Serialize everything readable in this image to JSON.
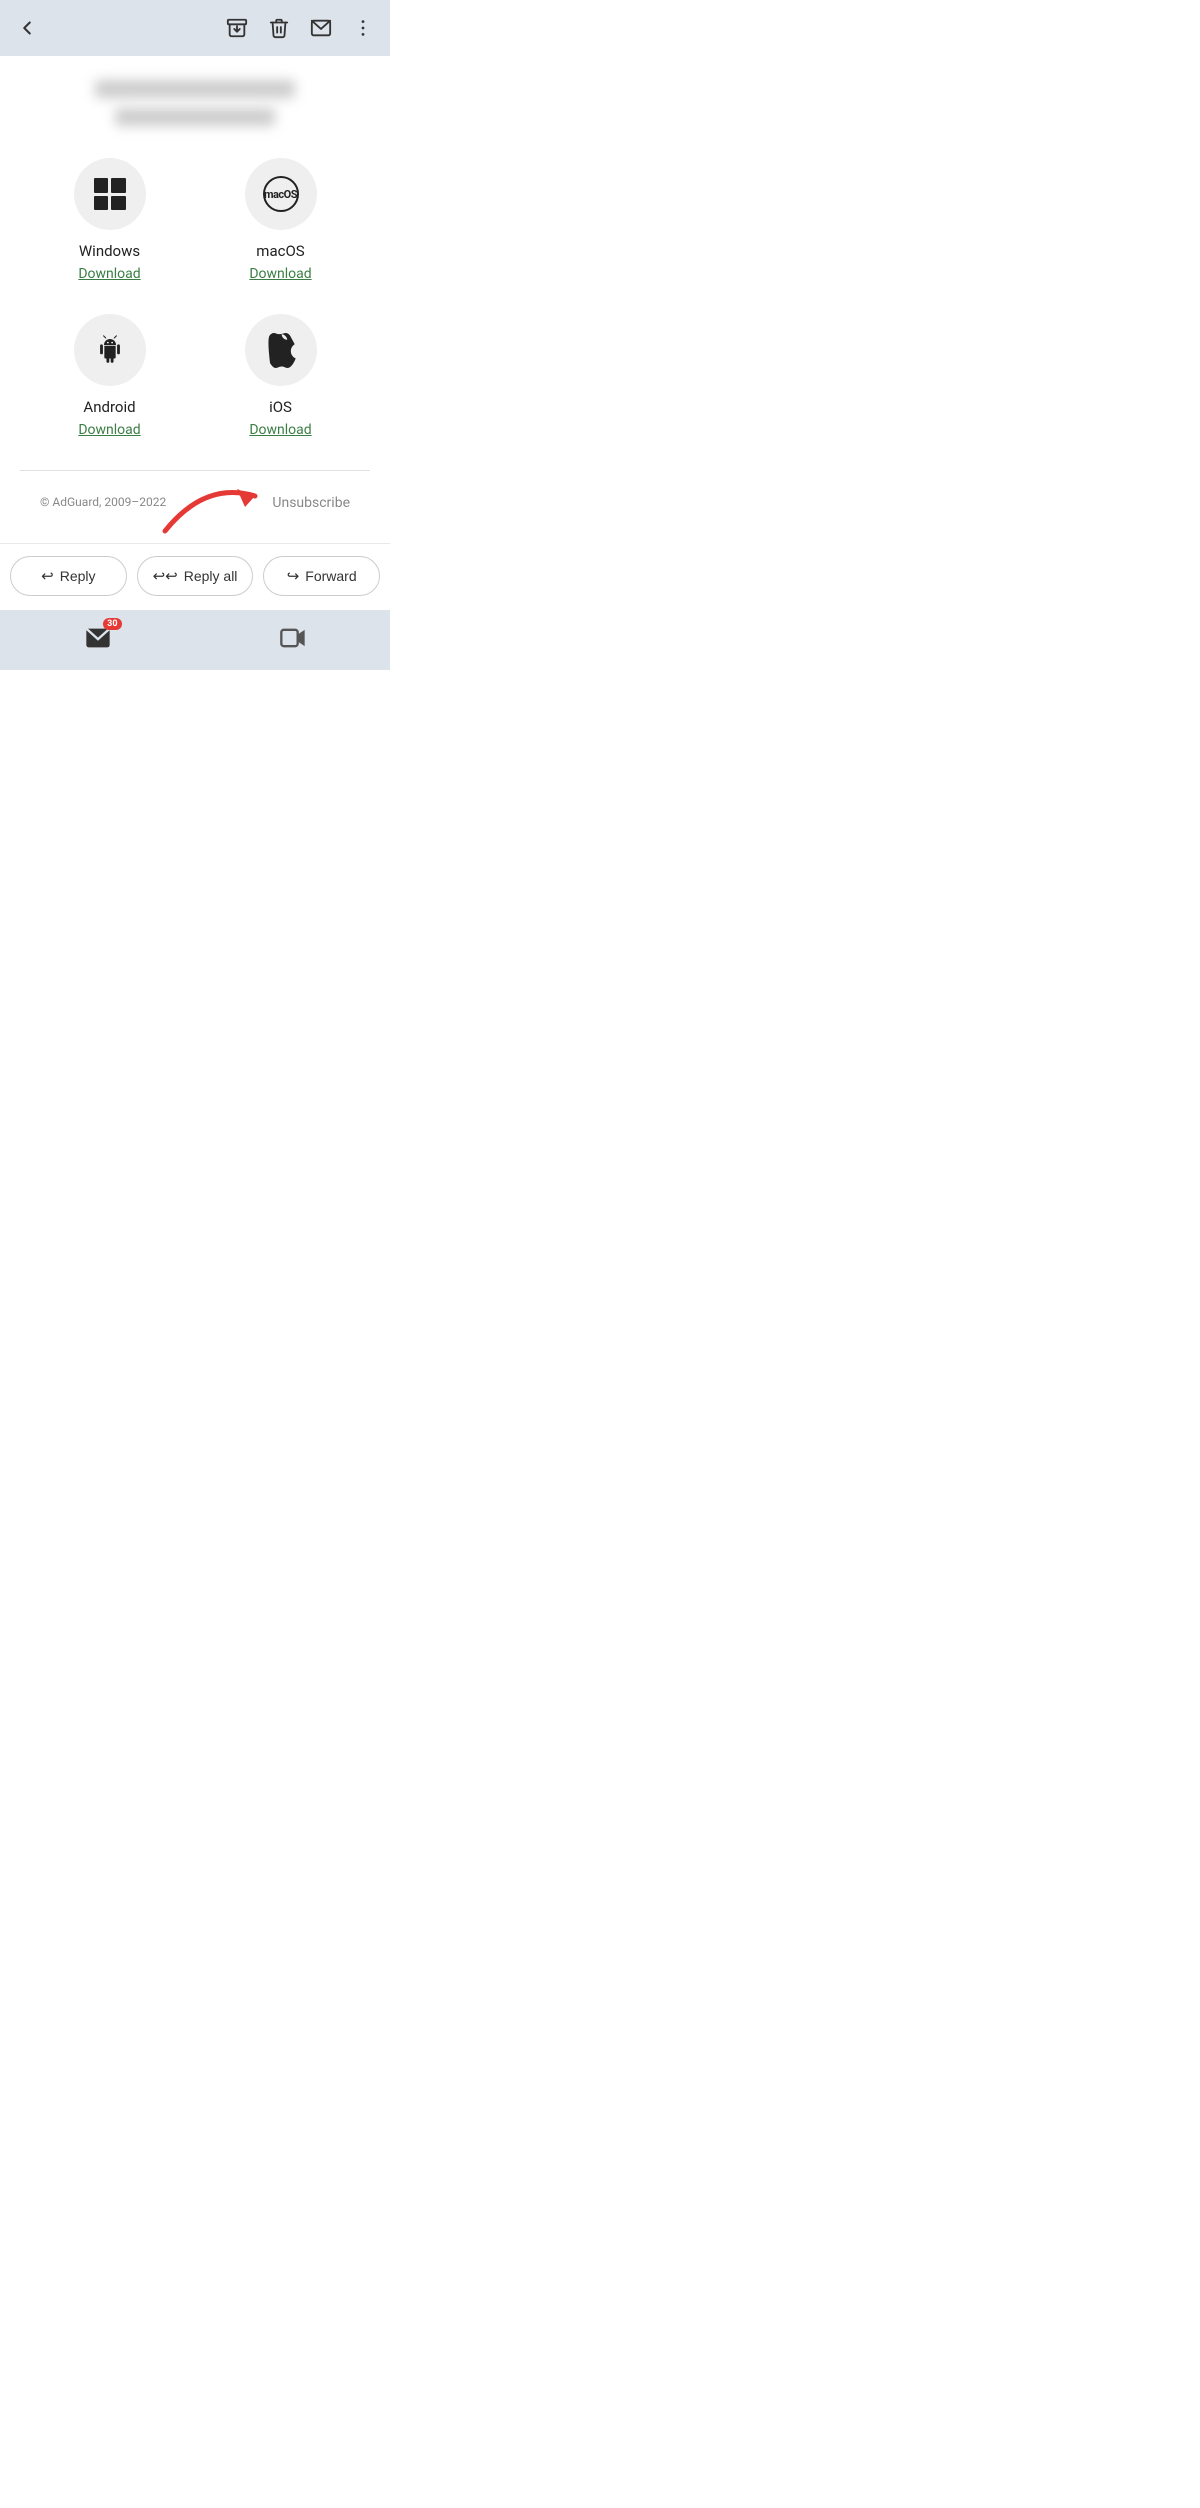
{
  "topbar": {
    "back_label": "←",
    "archive_label": "Archive",
    "delete_label": "Delete",
    "mail_label": "Mail",
    "more_label": "More"
  },
  "email": {
    "blurred_lines": [
      "blurred sender name",
      "blurred subject line"
    ],
    "platforms": [
      {
        "id": "windows",
        "name": "Windows",
        "download_label": "Download"
      },
      {
        "id": "macos",
        "name": "macOS",
        "download_label": "Download"
      },
      {
        "id": "android",
        "name": "Android",
        "download_label": "Download"
      },
      {
        "id": "ios",
        "name": "iOS",
        "download_label": "Download"
      }
    ],
    "footer": {
      "copyright": "© AdGuard, 2009–2022",
      "unsubscribe": "Unsubscribe"
    }
  },
  "actions": {
    "reply_label": "Reply",
    "reply_all_label": "Reply all",
    "forward_label": "Forward"
  },
  "bottomnav": {
    "mail_badge": "30"
  }
}
